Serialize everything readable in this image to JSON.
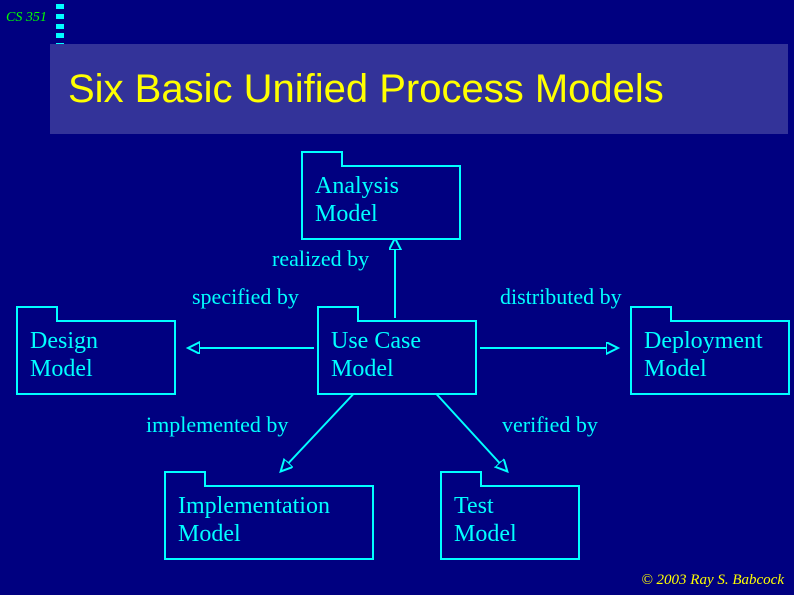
{
  "course": "CS 351",
  "title": "Six Basic Unified Process Models",
  "boxes": {
    "analysis_l1": "Analysis",
    "analysis_l2": "Model",
    "usecase_l1": "Use Case",
    "usecase_l2": "Model",
    "design_l1": "Design",
    "design_l2": "Model",
    "deploy_l1": "Deployment",
    "deploy_l2": "Model",
    "impl_l1": "Implementation",
    "impl_l2": "Model",
    "test_l1": "Test",
    "test_l2": "Model"
  },
  "relations": {
    "realized_by": "realized by",
    "specified_by": "specified by",
    "distributed_by": "distributed by",
    "implemented_by": "implemented by",
    "verified_by": "verified by"
  },
  "copyright": "© 2003  Ray S. Babcock"
}
